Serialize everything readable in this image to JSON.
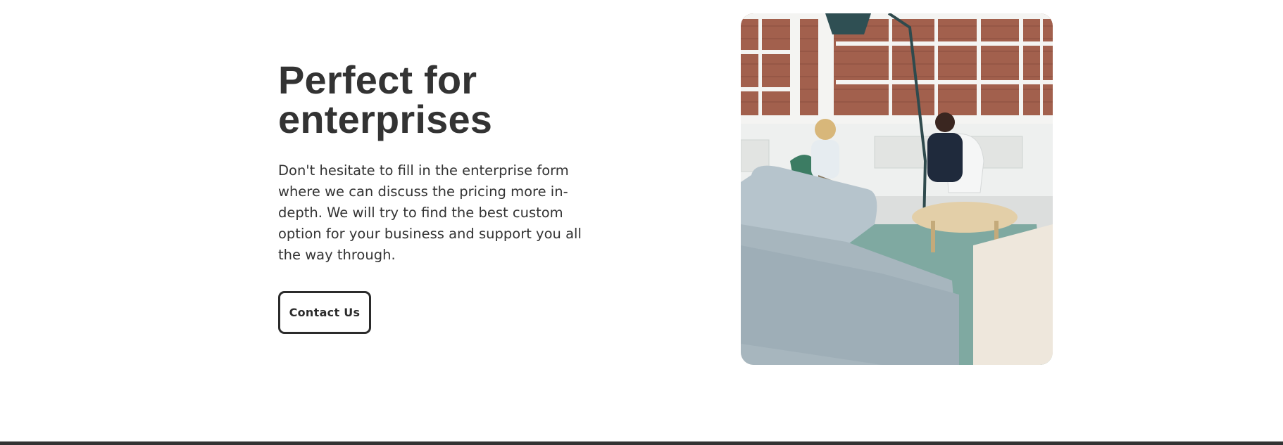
{
  "hero": {
    "title": "Perfect for enterprises",
    "description": "Don't hesitate to fill in the enterprise form where we can discuss the pricing more in-depth. We will try to find the best custom option for your business and support you all the way through.",
    "cta_label": "Contact Us"
  },
  "colors": {
    "text": "#333333",
    "button_border": "#2b2b2b",
    "footer_bar": "#333333"
  }
}
